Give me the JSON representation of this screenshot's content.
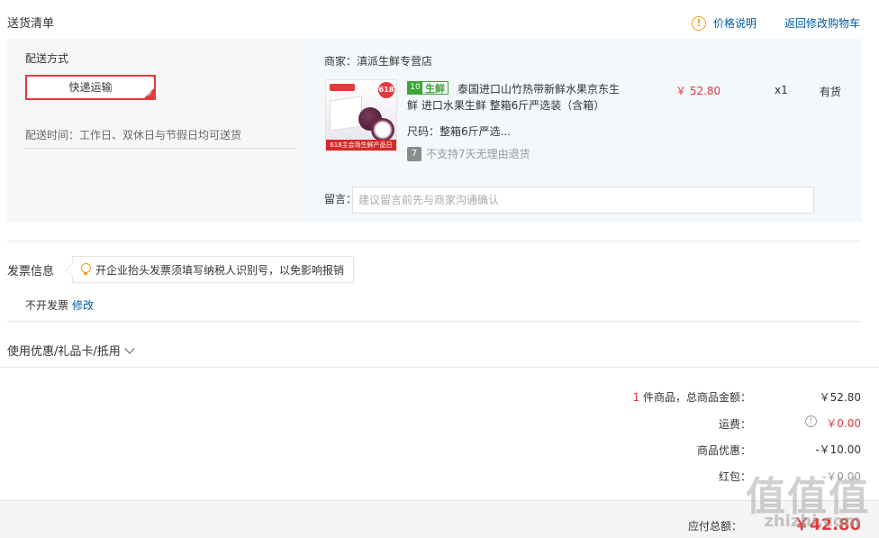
{
  "header": {
    "title": "送货清单",
    "price_info": "价格说明",
    "back_to_cart": "返回修改购物车"
  },
  "shipping": {
    "method_label": "配送方式",
    "method": "快递运输",
    "time": "配送时间：工作日、双休日与节假日均可送货"
  },
  "store": {
    "label": "商家：滇派生鲜专营店"
  },
  "product": {
    "img_badge": "618",
    "img_banner": "618主会场生鲜产品日",
    "fresh_tag": "生鲜",
    "title": "泰国进口山竹热带新鲜水果京东生鲜 进口水果生鲜 整箱6斤严选装（含箱）",
    "spec": "尺码：整箱6斤严选...",
    "return_icon": "7",
    "no_return": "不支持7天无理由退货",
    "price": "￥ 52.80",
    "qty": "x1",
    "stock": "有货"
  },
  "remark": {
    "label": "留言：",
    "placeholder": "建议留言前先与商家沟通确认"
  },
  "invoice": {
    "label": "发票信息",
    "tip": "开企业抬头发票须填写纳税人识别号，以免影响报销",
    "status": "不开发票",
    "edit": "修改"
  },
  "coupon": {
    "label": "使用优惠/礼品卡/抵用"
  },
  "summary": {
    "count": "1",
    "items_label": " 件商品，总商品金额：",
    "items_total": "￥52.80",
    "shipping_label": "运费：",
    "shipping_value": "￥0.00",
    "discount_label": "商品优惠：",
    "discount_value": "-￥10.00",
    "redpacket_label": "红包：",
    "redpacket_value": "-￥0.00",
    "payable_label": "应付总额：",
    "payable_value": "￥42.80"
  },
  "watermark": {
    "logo": "值值值",
    "url": "zhizhi.com"
  }
}
